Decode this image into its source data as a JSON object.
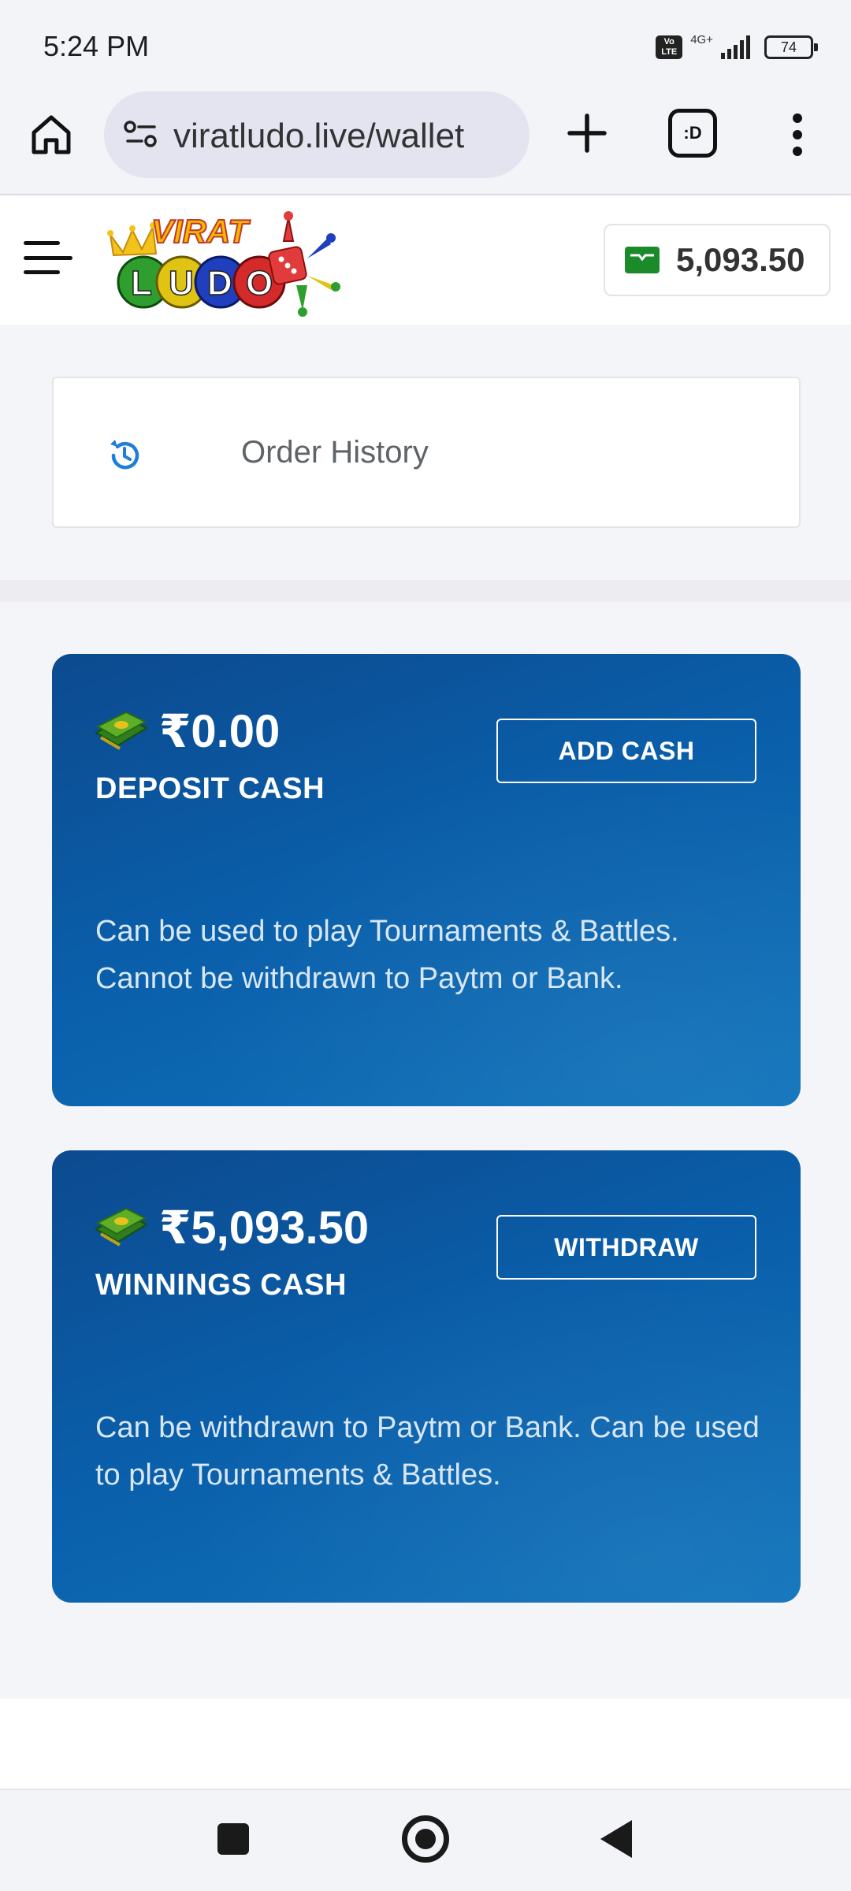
{
  "status_bar": {
    "time": "5:24 PM",
    "volte": "Vo LTE",
    "network": "4G+",
    "battery": "74"
  },
  "browser": {
    "url": "viratludo.live/wallet",
    "tabs_label": ":D"
  },
  "header": {
    "logo_top": "VIRAT",
    "logo_bottom": "LUDO",
    "wallet_balance": "5,093.50"
  },
  "order_history": {
    "label": "Order History"
  },
  "cards": [
    {
      "amount": "₹0.00",
      "label": "DEPOSIT CASH",
      "button": "ADD CASH",
      "description": "Can be used to play Tournaments & Battles. Cannot be withdrawn to Paytm or Bank."
    },
    {
      "amount": "₹5,093.50",
      "label": "WINNINGS CASH",
      "button": "WITHDRAW",
      "description": "Can be withdrawn to Paytm or Bank. Can be used to play Tournaments & Battles."
    }
  ],
  "colors": {
    "card_blue": "#0a5ea9",
    "history_icon": "#1e7fd8",
    "wallet_green": "#1a8a2a"
  },
  "icons": [
    "home-icon",
    "site-settings-icon",
    "plus-icon",
    "tabs-icon",
    "more-vert-icon",
    "hamburger-icon",
    "wallet-icon",
    "history-icon",
    "money-icon"
  ]
}
